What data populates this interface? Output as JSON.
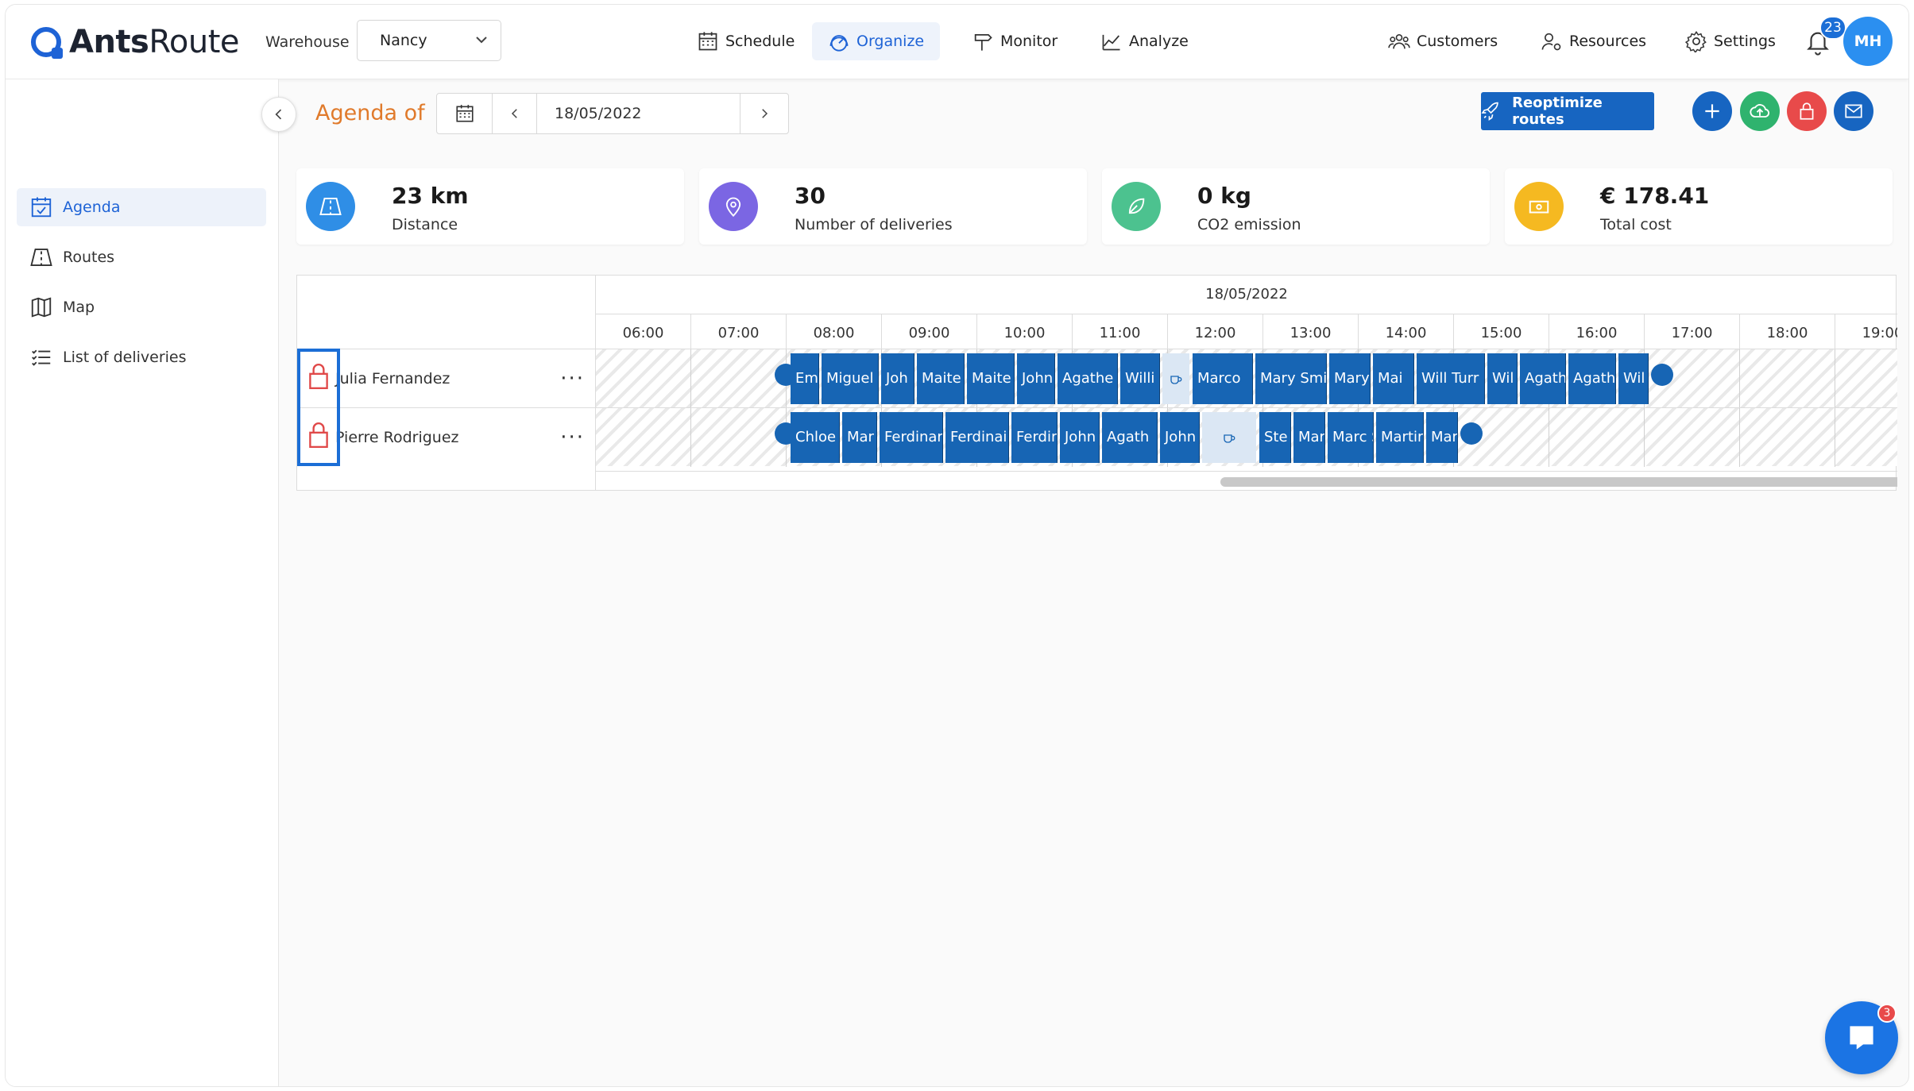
{
  "app": {
    "logo_bold": "Ants",
    "logo_light": "Route"
  },
  "header": {
    "warehouse_label": "Warehouse",
    "warehouse_value": "Nancy",
    "nav": [
      {
        "label": "Schedule",
        "icon": "calendar-icon"
      },
      {
        "label": "Organize",
        "icon": "gauge-icon",
        "active": true
      },
      {
        "label": "Monitor",
        "icon": "signpost-icon"
      },
      {
        "label": "Analyze",
        "icon": "chart-icon"
      }
    ],
    "right_nav": [
      {
        "label": "Customers",
        "icon": "users-icon"
      },
      {
        "label": "Resources",
        "icon": "user-gear-icon"
      },
      {
        "label": "Settings",
        "icon": "gear-icon"
      }
    ],
    "notifications_count": "23",
    "avatar_initials": "MH"
  },
  "sidebar": {
    "items": [
      {
        "label": "Agenda",
        "active": true
      },
      {
        "label": "Routes"
      },
      {
        "label": "Map"
      },
      {
        "label": "List of deliveries"
      }
    ]
  },
  "agenda": {
    "title": "Agenda of",
    "date": "18/05/2022",
    "reoptimize_label": "Reoptimize routes"
  },
  "stats": [
    {
      "value": "23 km",
      "label": "Distance",
      "color": "#2f8ee6",
      "icon": "map-icon"
    },
    {
      "value": "30",
      "label": "Number of deliveries",
      "color": "#7b66e3",
      "icon": "pin-icon"
    },
    {
      "value": "0 kg",
      "label": "CO2 emission",
      "color": "#4cc28f",
      "icon": "leaf-icon"
    },
    {
      "value": "€ 178.41",
      "label": "Total cost",
      "color": "#f5b921",
      "icon": "money-icon"
    }
  ],
  "gantt": {
    "date": "18/05/2022",
    "hours": [
      "06:00",
      "07:00",
      "08:00",
      "09:00",
      "10:00",
      "11:00",
      "12:00",
      "13:00",
      "14:00",
      "15:00",
      "16:00",
      "17:00",
      "18:00",
      "19:00"
    ],
    "resources": [
      {
        "name": "Julia Fernandez",
        "tasks": [
          "Em",
          "Miguel",
          "Joh",
          "Maite",
          "Maite",
          "John",
          "Agathe",
          "Willi",
          "Marco",
          "Mary Smi",
          "Mary",
          "Mai",
          "Will Turr",
          "Wil",
          "Agath",
          "Agath",
          "Wil"
        ]
      },
      {
        "name": "Pierre Rodriguez",
        "tasks": [
          "Chloe",
          "Mar",
          "Ferdinar",
          "Ferdinai",
          "Ferdir",
          "John",
          "Agath",
          "John",
          "Ste",
          "Mar",
          "Marc S",
          "Martir",
          "Mar"
        ]
      }
    ]
  },
  "chat": {
    "badge": "3"
  },
  "colors": {
    "accent": "#1e63d6",
    "task": "#1765b4",
    "title": "#e07a2b",
    "lock": "#e04848"
  }
}
